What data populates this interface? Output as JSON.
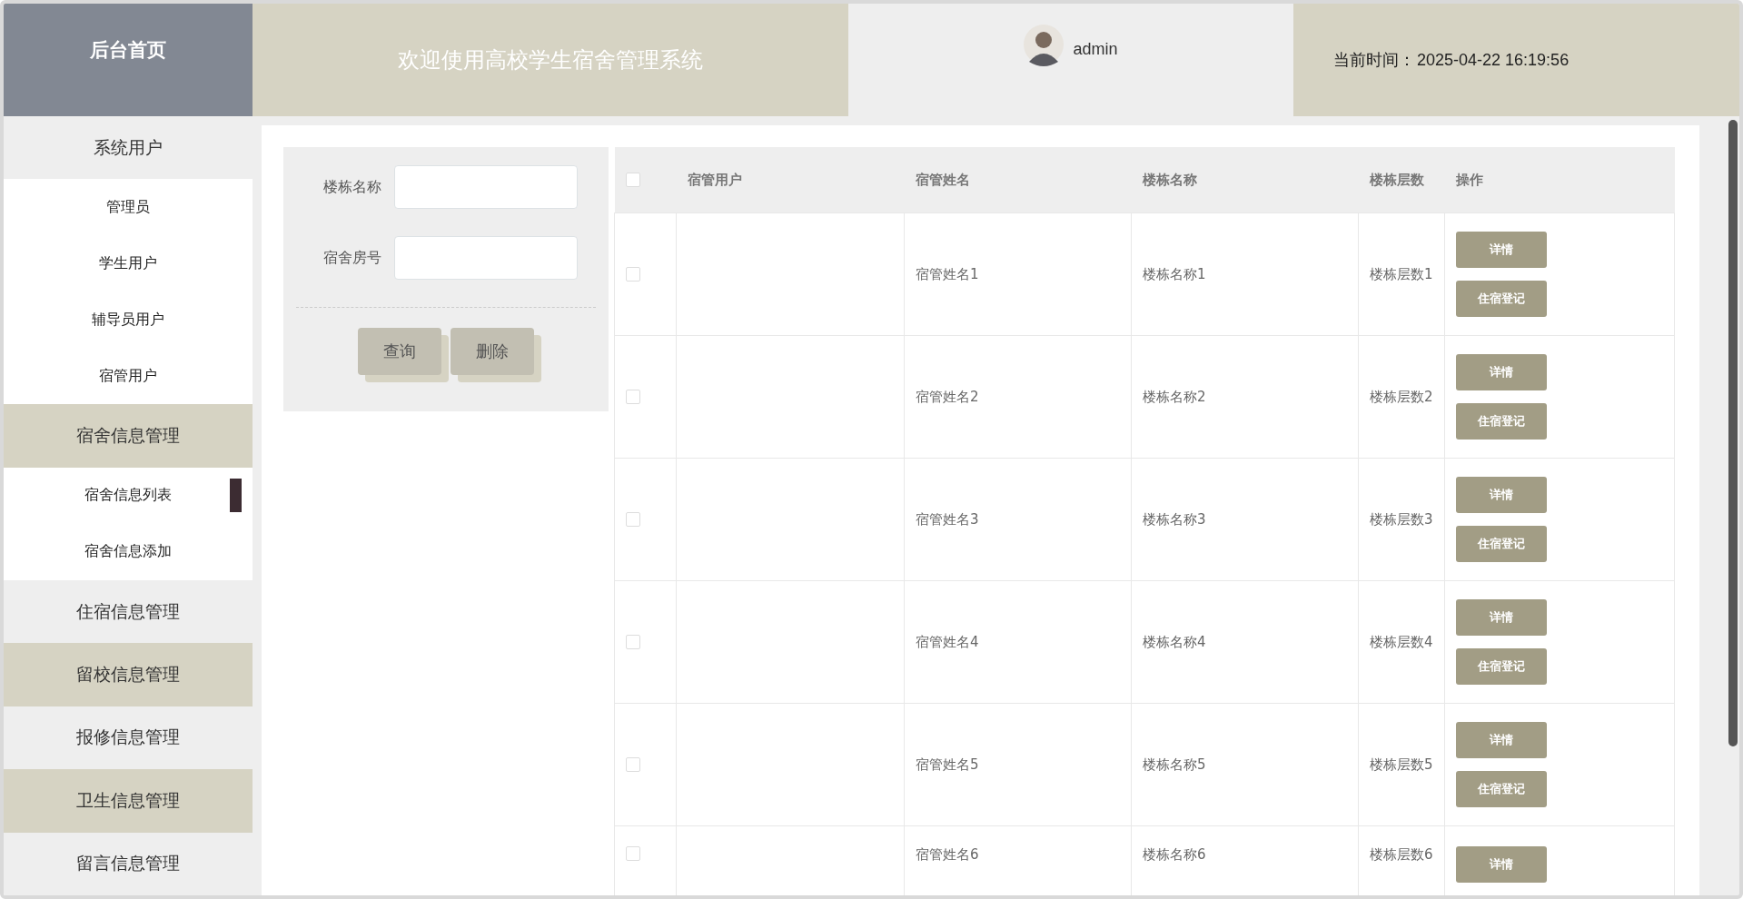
{
  "header": {
    "home": "后台首页",
    "title": "欢迎使用高校学生宿舍管理系统",
    "user": "admin",
    "time_label": "当前时间：",
    "time": "2025-04-22 16:19:56"
  },
  "sidebar": {
    "groups": [
      {
        "label": "系统用户",
        "children": [
          {
            "label": "管理员",
            "selected": false
          },
          {
            "label": "学生用户",
            "selected": false
          },
          {
            "label": "辅导员用户",
            "selected": false
          },
          {
            "label": "宿管用户",
            "selected": false
          }
        ]
      },
      {
        "label": "宿舍信息管理",
        "children": [
          {
            "label": "宿舍信息列表",
            "selected": true
          },
          {
            "label": "宿舍信息添加",
            "selected": false
          }
        ]
      },
      {
        "label": "住宿信息管理"
      },
      {
        "label": "留校信息管理"
      },
      {
        "label": "报修信息管理"
      },
      {
        "label": "卫生信息管理"
      },
      {
        "label": "留言信息管理"
      }
    ]
  },
  "search": {
    "fields": [
      {
        "label": "楼栋名称"
      },
      {
        "label": "宿舍房号"
      }
    ],
    "buttons": [
      "查询",
      "删除"
    ]
  },
  "table": {
    "columns": [
      "宿管用户",
      "宿管姓名",
      "楼栋名称",
      "楼栋层数",
      "操作"
    ],
    "all_checked": false,
    "rows": [
      {
        "checked": false,
        "cells": [
          "",
          "宿管姓名1",
          "楼栋名称1",
          "楼栋层数1"
        ],
        "actions": [
          "详情",
          "住宿登记"
        ]
      },
      {
        "checked": false,
        "cells": [
          "",
          "宿管姓名2",
          "楼栋名称2",
          "楼栋层数2"
        ],
        "actions": [
          "详情",
          "住宿登记"
        ]
      },
      {
        "checked": false,
        "cells": [
          "",
          "宿管姓名3",
          "楼栋名称3",
          "楼栋层数3"
        ],
        "actions": [
          "详情",
          "住宿登记"
        ]
      },
      {
        "checked": false,
        "cells": [
          "",
          "宿管姓名4",
          "楼栋名称4",
          "楼栋层数4"
        ],
        "actions": [
          "详情",
          "住宿登记"
        ]
      },
      {
        "checked": false,
        "cells": [
          "",
          "宿管姓名5",
          "楼栋名称5",
          "楼栋层数5"
        ],
        "actions": [
          "详情",
          "住宿登记"
        ]
      },
      {
        "checked": false,
        "cells": [
          "",
          "宿管姓名6",
          "楼栋名称6",
          "楼栋层数6"
        ],
        "actions": [
          "详情"
        ]
      }
    ]
  }
}
